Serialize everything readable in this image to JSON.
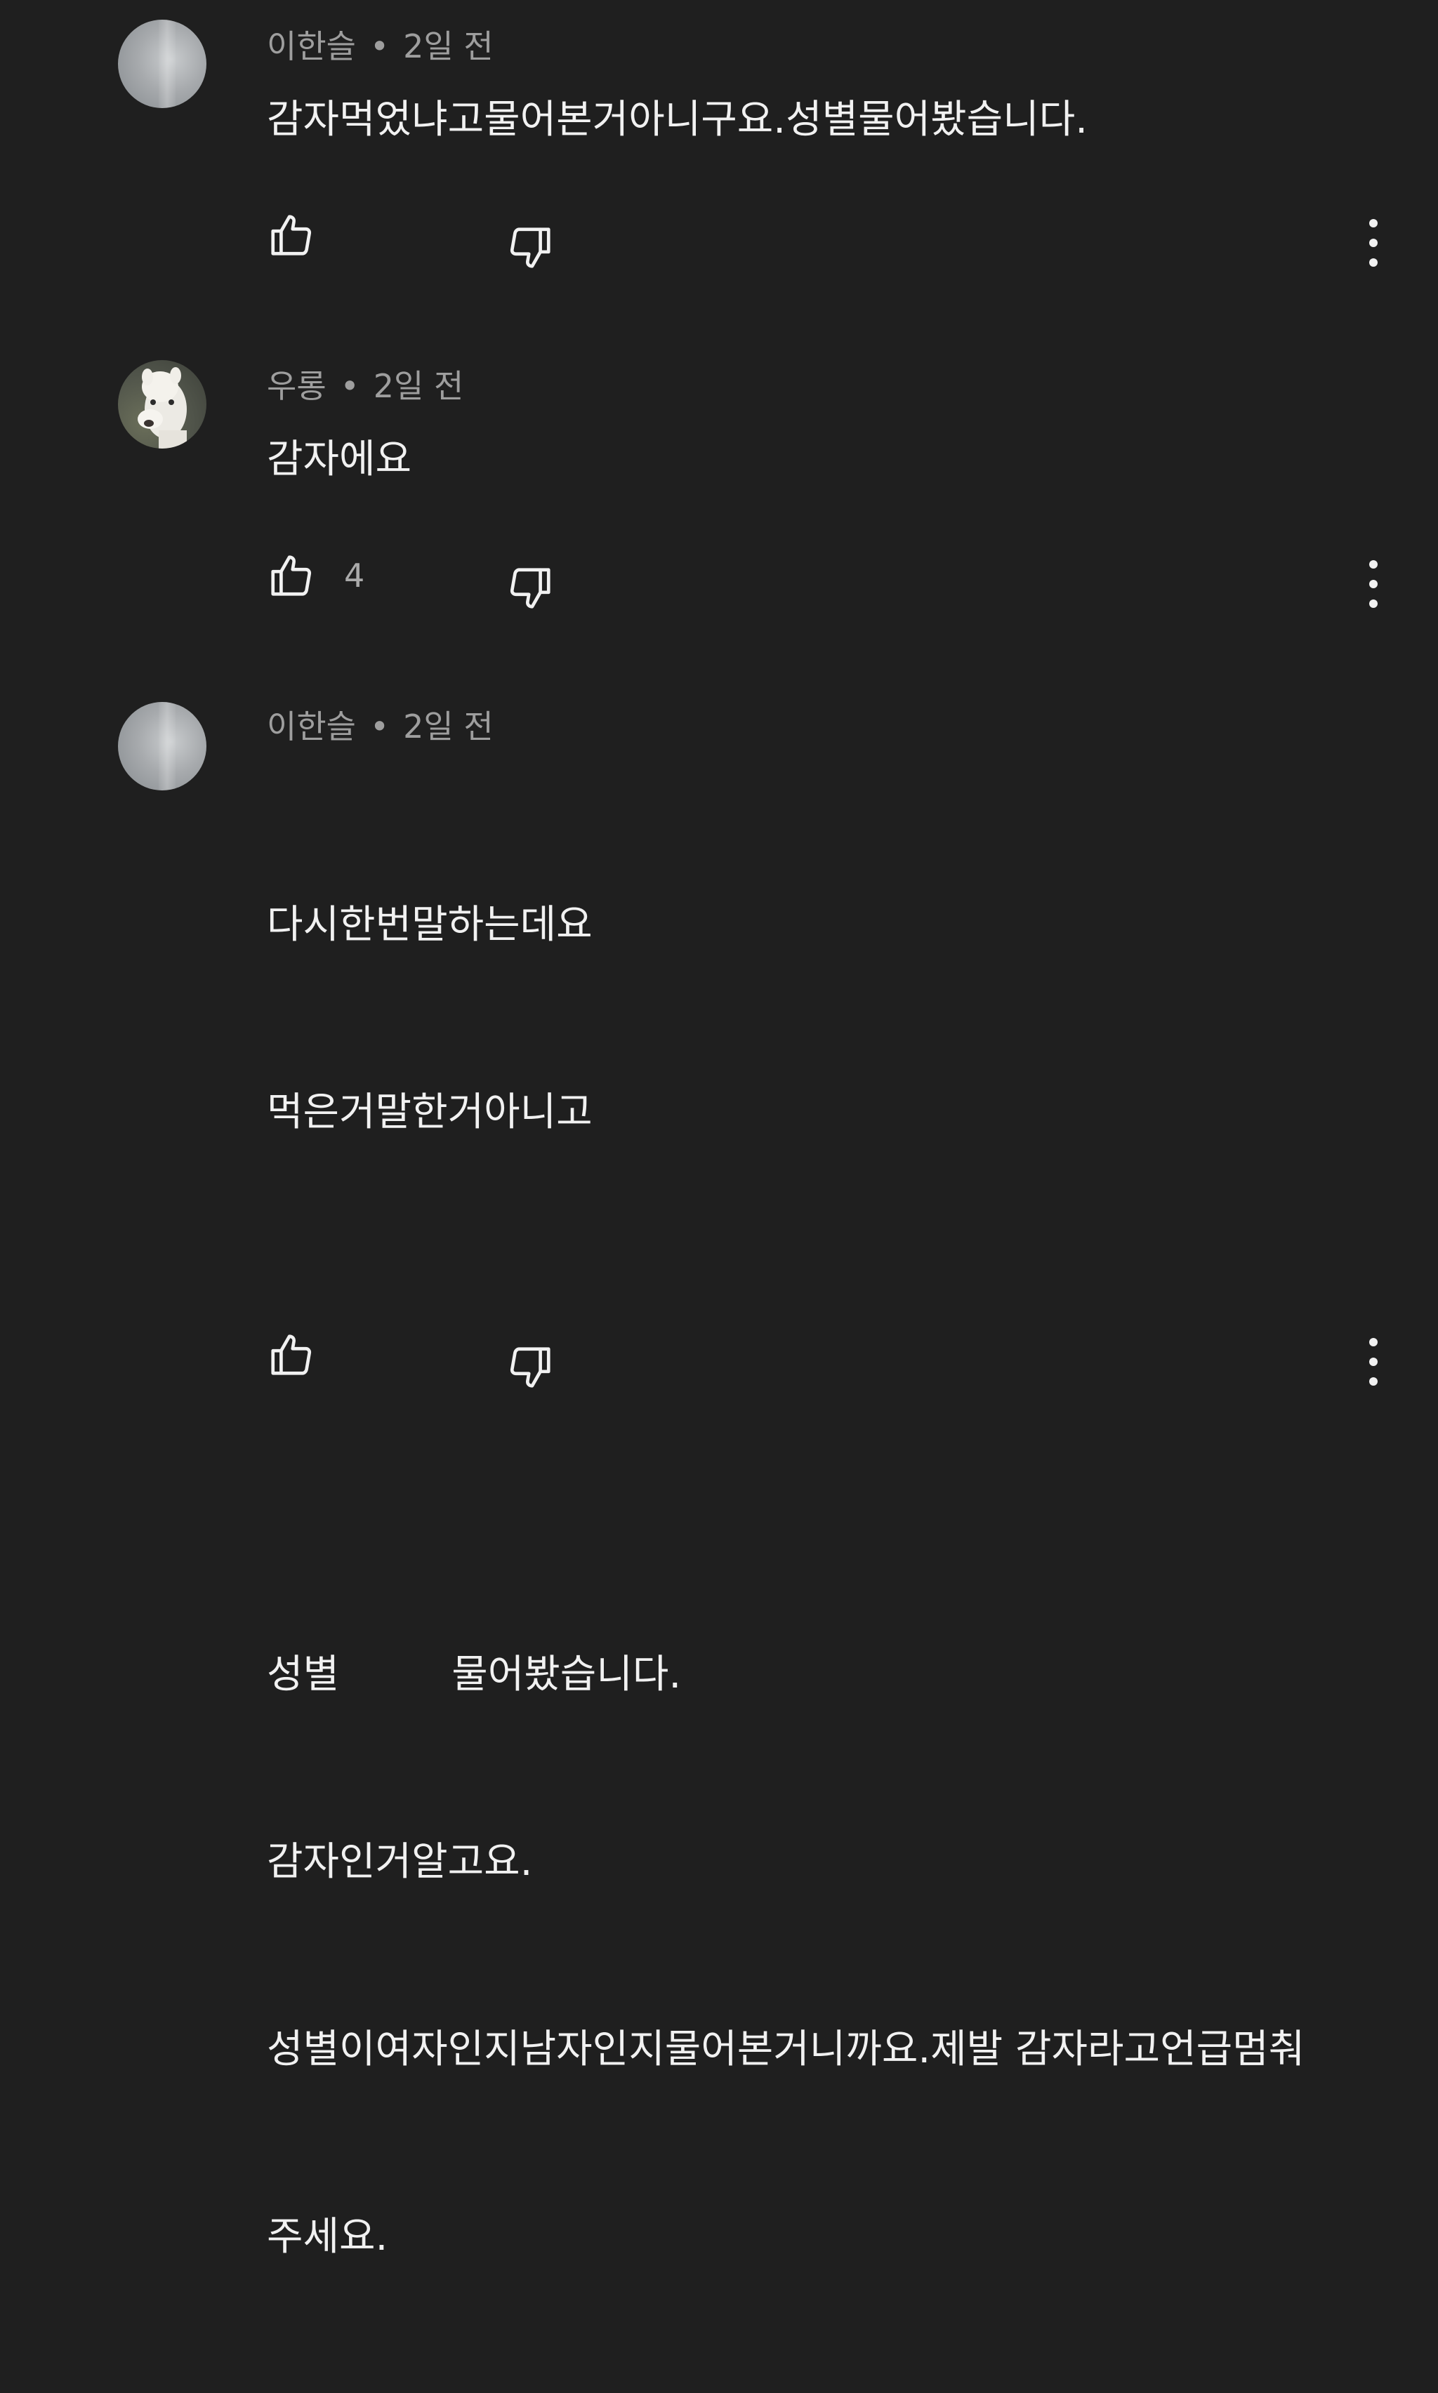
{
  "comments": [
    {
      "author": "이한슬",
      "separator": "•",
      "time": "2일 전",
      "lines": [
        "감자먹었냐고물어본거아니구요.성별물어봤습니다."
      ],
      "likes": "",
      "avatar": "gray-blurred-avatar"
    },
    {
      "author": "우롱",
      "separator": "•",
      "time": "2일 전",
      "lines": [
        "감자에요"
      ],
      "likes": "4",
      "avatar": "alpaca-avatar"
    },
    {
      "author": "이한슬",
      "separator": "•",
      "time": "2일 전",
      "lines": [
        "다시한번말하는데요",
        "먹은거말한거아니고",
        "",
        "",
        "성별         물어봤습니다.",
        "감자인거알고요.",
        "성별이여자인지남자인지물어본거니까요.제발 감자라고언급멈춰",
        "주세요."
      ],
      "likes": "",
      "avatar": "gray-blurred-avatar"
    }
  ],
  "icons": {
    "like": "thumbs-up-icon",
    "dislike": "thumbs-down-icon",
    "more": "more-vert-icon"
  },
  "colors": {
    "background": "#1f1f1f",
    "text": "#f1f1f1",
    "meta": "#9e9e9e"
  }
}
